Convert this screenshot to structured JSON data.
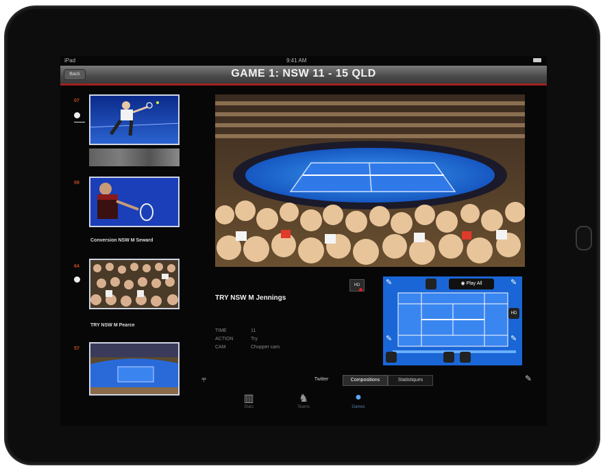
{
  "status_bar": {
    "carrier": "iPad",
    "time": "9:41 AM"
  },
  "nav": {
    "back_label": "Back",
    "title": "GAME 1: NSW  11 - 15  QLD"
  },
  "plays": [
    {
      "number": "07",
      "caption": ""
    },
    {
      "number": "59",
      "caption": "Conversion NSW M Seward"
    },
    {
      "number": "64",
      "caption": "TRY NSW M Pearce"
    },
    {
      "number": "57",
      "caption": ""
    }
  ],
  "selected_play": {
    "title": "TRY NSW M Jennings",
    "details": [
      {
        "label": "TIME",
        "value": "11"
      },
      {
        "label": "ACTION",
        "value": "Try"
      },
      {
        "label": "CAM",
        "value": "Chopper cam"
      }
    ],
    "hd_badge": "HD"
  },
  "court_panel": {
    "play_all_label": "Play All",
    "hd_label": "HD"
  },
  "segments": {
    "left": "Twitter",
    "active": "Compositions",
    "right": "Statistiques"
  },
  "tabs": [
    {
      "label": "Stats",
      "icon": "stadium-icon"
    },
    {
      "label": "Teams",
      "icon": "jersey-icon"
    },
    {
      "label": "Games",
      "icon": "ball-icon",
      "active": true
    }
  ],
  "colors": {
    "accent_red": "#a32020",
    "court_blue": "#1a66d6",
    "active_tab": "#5aa8ff"
  }
}
